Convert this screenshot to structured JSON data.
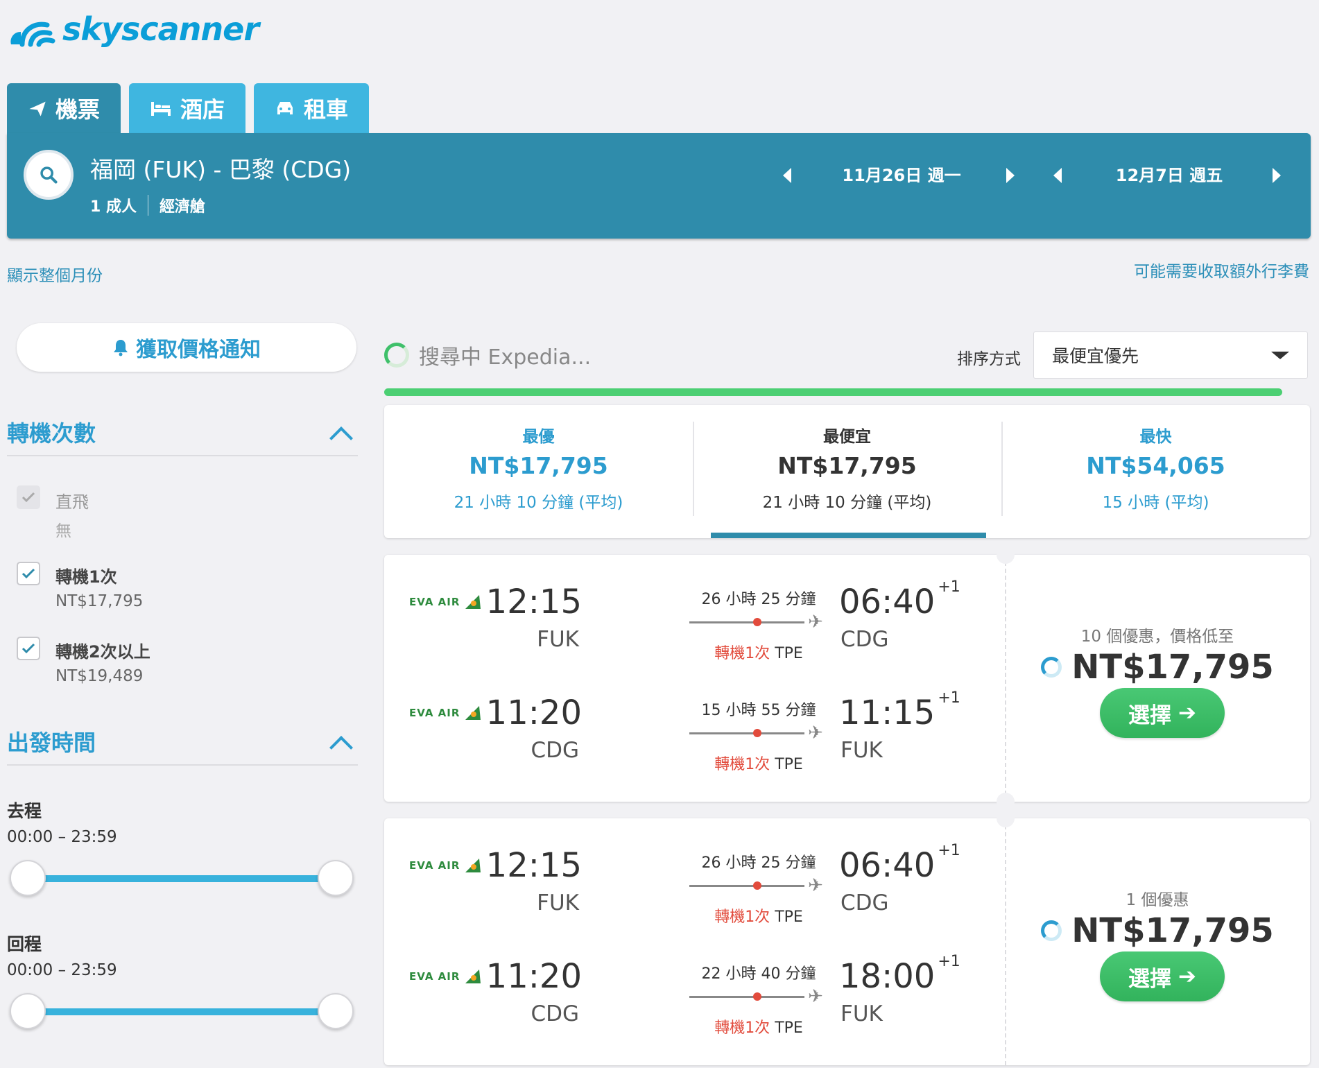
{
  "brand": {
    "name": "skyscanner",
    "color": "#0b9ed8"
  },
  "tabs": [
    {
      "label": "機票",
      "icon": "plane-icon",
      "active": true
    },
    {
      "label": "酒店",
      "icon": "bed-icon",
      "active": false
    },
    {
      "label": "租車",
      "icon": "car-icon",
      "active": false
    }
  ],
  "search": {
    "route": "福岡 (FUK) - 巴黎 (CDG)",
    "passengers": "1 成人",
    "cabin": "經濟艙",
    "depart_date": "11月26日 週一",
    "return_date": "12月7日 週五"
  },
  "links": {
    "show_month": "顯示整個月份",
    "baggage": "可能需要收取額外行李費"
  },
  "sidebar": {
    "alert_button": "獲取價格通知",
    "stops": {
      "title": "轉機次數",
      "options": [
        {
          "label": "直飛",
          "price": "無",
          "checked": true,
          "disabled": true
        },
        {
          "label": "轉機1次",
          "price": "NT$17,795",
          "checked": true,
          "disabled": false
        },
        {
          "label": "轉機2次以上",
          "price": "NT$19,489",
          "checked": true,
          "disabled": false
        }
      ]
    },
    "times": {
      "title": "出發時間",
      "outbound": {
        "label": "去程",
        "range": "00:00 – 23:59"
      },
      "return": {
        "label": "回程",
        "range": "00:00 – 23:59"
      }
    }
  },
  "results_header": {
    "searching": "搜尋中 Expedia...",
    "sort_label": "排序方式",
    "sort_value": "最便宜優先",
    "progress": 1.0
  },
  "summary": [
    {
      "label": "最優",
      "price": "NT$17,795",
      "duration": "21 小時 10 分鐘 (平均)",
      "active": false
    },
    {
      "label": "最便宜",
      "price": "NT$17,795",
      "duration": "21 小時 10 分鐘 (平均)",
      "active": true
    },
    {
      "label": "最快",
      "price": "NT$54,065",
      "duration": "15 小時 (平均)",
      "active": false
    }
  ],
  "results": [
    {
      "legs": [
        {
          "airline": "EVA AIR",
          "dep_time": "12:15",
          "dep_code": "FUK",
          "duration": "26 小時 25 分鐘",
          "stops": "轉機1次",
          "via": "TPE",
          "arr_time": "06:40",
          "arr_offset": "+1",
          "arr_code": "CDG"
        },
        {
          "airline": "EVA AIR",
          "dep_time": "11:20",
          "dep_code": "CDG",
          "duration": "15 小時 55 分鐘",
          "stops": "轉機1次",
          "via": "TPE",
          "arr_time": "11:15",
          "arr_offset": "+1",
          "arr_code": "FUK"
        }
      ],
      "deals": "10 個優惠，價格低至",
      "price": "NT$17,795",
      "select": "選擇"
    },
    {
      "legs": [
        {
          "airline": "EVA AIR",
          "dep_time": "12:15",
          "dep_code": "FUK",
          "duration": "26 小時 25 分鐘",
          "stops": "轉機1次",
          "via": "TPE",
          "arr_time": "06:40",
          "arr_offset": "+1",
          "arr_code": "CDG"
        },
        {
          "airline": "EVA AIR",
          "dep_time": "11:20",
          "dep_code": "CDG",
          "duration": "22 小時 40 分鐘",
          "stops": "轉機1次",
          "via": "TPE",
          "arr_time": "18:00",
          "arr_offset": "+1",
          "arr_code": "FUK"
        }
      ],
      "deals": "1 個優惠",
      "price": "NT$17,795",
      "select": "選擇"
    }
  ]
}
